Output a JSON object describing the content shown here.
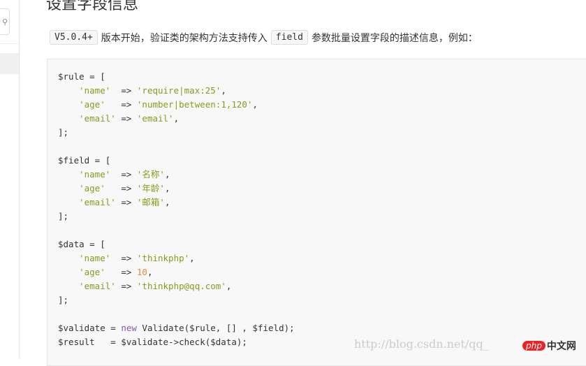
{
  "sidebar": {
    "search_icon": "search-icon"
  },
  "heading": "设置字段信息",
  "intro": {
    "version": "V5.0.4+",
    "text1": "版本开始，验证类的架构方法支持传入",
    "code": "field",
    "text2": "参数批量设置字段的描述信息，例如："
  },
  "code_lines": [
    [
      [
        "p",
        "$rule = ["
      ]
    ],
    [
      [
        "p",
        "    "
      ],
      [
        "s",
        "'name'"
      ],
      [
        "p",
        "  => "
      ],
      [
        "s",
        "'require|max:25'"
      ],
      [
        "p",
        ","
      ]
    ],
    [
      [
        "p",
        "    "
      ],
      [
        "s",
        "'age'"
      ],
      [
        "p",
        "   => "
      ],
      [
        "s",
        "'number|between:1,120'"
      ],
      [
        "p",
        ","
      ]
    ],
    [
      [
        "p",
        "    "
      ],
      [
        "s",
        "'email'"
      ],
      [
        "p",
        " => "
      ],
      [
        "s",
        "'email'"
      ],
      [
        "p",
        ","
      ]
    ],
    [
      [
        "p",
        "];"
      ]
    ],
    [
      [
        "p",
        ""
      ]
    ],
    [
      [
        "p",
        "$field = ["
      ]
    ],
    [
      [
        "p",
        "    "
      ],
      [
        "s",
        "'name'"
      ],
      [
        "p",
        "  => "
      ],
      [
        "s",
        "'名称'"
      ],
      [
        "p",
        ","
      ]
    ],
    [
      [
        "p",
        "    "
      ],
      [
        "s",
        "'age'"
      ],
      [
        "p",
        "   => "
      ],
      [
        "s",
        "'年龄'"
      ],
      [
        "p",
        ","
      ]
    ],
    [
      [
        "p",
        "    "
      ],
      [
        "s",
        "'email'"
      ],
      [
        "p",
        " => "
      ],
      [
        "s",
        "'邮箱'"
      ],
      [
        "p",
        ","
      ]
    ],
    [
      [
        "p",
        "];"
      ]
    ],
    [
      [
        "p",
        ""
      ]
    ],
    [
      [
        "p",
        "$data = ["
      ]
    ],
    [
      [
        "p",
        "    "
      ],
      [
        "s",
        "'name'"
      ],
      [
        "p",
        "  => "
      ],
      [
        "s",
        "'thinkphp'"
      ],
      [
        "p",
        ","
      ]
    ],
    [
      [
        "p",
        "    "
      ],
      [
        "s",
        "'age'"
      ],
      [
        "p",
        "   => "
      ],
      [
        "n",
        "10"
      ],
      [
        "p",
        ","
      ]
    ],
    [
      [
        "p",
        "    "
      ],
      [
        "s",
        "'email'"
      ],
      [
        "p",
        " => "
      ],
      [
        "s",
        "'thinkphp@qq.com'"
      ],
      [
        "p",
        ","
      ]
    ],
    [
      [
        "p",
        "];"
      ]
    ],
    [
      [
        "p",
        ""
      ]
    ],
    [
      [
        "p",
        "$validate = "
      ],
      [
        "k",
        "new"
      ],
      [
        "p",
        " Validate($rule, [] , $field);"
      ]
    ],
    [
      [
        "p",
        "$result   = $validate->check($data);"
      ]
    ]
  ],
  "watermark": "http://blog.csdn.net/qq_",
  "logo": {
    "badge": "php",
    "text": "中文网"
  }
}
